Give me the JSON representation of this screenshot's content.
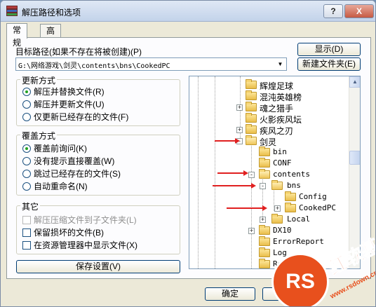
{
  "window": {
    "title": "解压路径和选项",
    "help_btn": "?",
    "close_btn": "X"
  },
  "tabs": [
    {
      "label": "常规"
    },
    {
      "label": "高级"
    }
  ],
  "target": {
    "label": "目标路径(如果不存在将被创建)(P)",
    "value": "G:\\网络游戏\\剑灵\\contents\\bns\\CookedPC",
    "show_btn": "显示(D)",
    "new_folder_btn": "新建文件夹(E)"
  },
  "update_mode": {
    "title": "更新方式",
    "options": [
      {
        "label": "解压并替换文件(R)",
        "selected": true
      },
      {
        "label": "解压并更新文件(U)",
        "selected": false
      },
      {
        "label": "仅更新已经存在的文件(F)",
        "selected": false
      }
    ]
  },
  "overwrite_mode": {
    "title": "覆盖方式",
    "options": [
      {
        "label": "覆盖前询问(K)",
        "selected": true
      },
      {
        "label": "没有提示直接覆盖(W)",
        "selected": false
      },
      {
        "label": "跳过已经存在的文件(S)",
        "selected": false
      },
      {
        "label": "自动重命名(N)",
        "selected": false
      }
    ]
  },
  "misc": {
    "title": "其它",
    "options": [
      {
        "label": "解压压缩文件到子文件夹(L)",
        "checked": false,
        "disabled": true
      },
      {
        "label": "保留损坏的文件(B)",
        "checked": false,
        "disabled": false
      },
      {
        "label": "在资源管理器中显示文件(X)",
        "checked": false,
        "disabled": false
      }
    ]
  },
  "save_btn": "保存设置(V)",
  "ok_btn": "确定",
  "tree": {
    "items": [
      {
        "label": "辉煌足球"
      },
      {
        "label": "混沌英雄榜"
      },
      {
        "label": "魂之猎手",
        "expander": "+"
      },
      {
        "label": "火影疾风坛"
      },
      {
        "label": "疾风之刃",
        "expander": "+"
      },
      {
        "label": "剑灵",
        "expander": "-"
      },
      {
        "label": "bin"
      },
      {
        "label": "CONF"
      },
      {
        "label": "contents",
        "expander": "-"
      },
      {
        "label": "bns",
        "expander": "-"
      },
      {
        "label": "Config"
      },
      {
        "label": "CookedPC",
        "expander": "+"
      },
      {
        "label": "Local",
        "expander": "+"
      },
      {
        "label": "DX10",
        "expander": "+"
      },
      {
        "label": "ErrorReport"
      },
      {
        "label": "Log"
      },
      {
        "label": "Reg"
      }
    ]
  },
  "watermark": {
    "text": "红软基地",
    "url": "www.rsdown.cn"
  }
}
